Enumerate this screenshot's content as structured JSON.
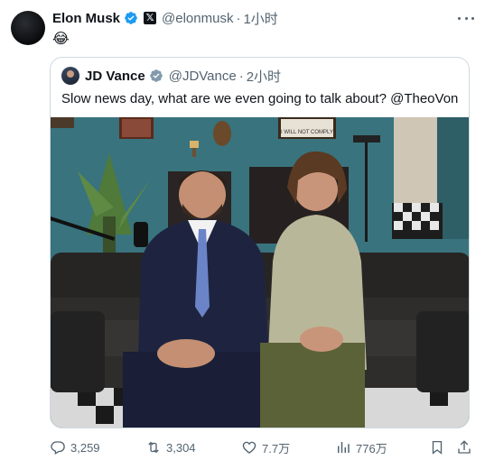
{
  "post": {
    "author_name": "Elon Musk",
    "author_handle": "@elonmusk",
    "separator": "·",
    "time": "1小时",
    "text": "😂",
    "icons": {
      "avatar": "profile-avatar",
      "verified": "verified-badge-icon",
      "affiliation": "x-logo-badge",
      "more": "more-options-icon"
    }
  },
  "quoted": {
    "author_name": "JD Vance",
    "author_handle": "@JDVance",
    "separator": "·",
    "time": "2小时",
    "text": "Slow news day, what are we even going to talk about? @TheoVon",
    "sign_text": "I WILL NOT COMPLY"
  },
  "actions": {
    "replies": "3,259",
    "reposts": "3,304",
    "likes": "7.7万",
    "views": "776万",
    "icons": [
      "reply-icon",
      "repost-icon",
      "like-icon",
      "views-icon",
      "bookmark-icon",
      "share-icon"
    ]
  },
  "colors": {
    "verified": "#1d9bf0",
    "text_primary": "#0f1419",
    "text_secondary": "#536471",
    "border": "#cfd9de"
  }
}
